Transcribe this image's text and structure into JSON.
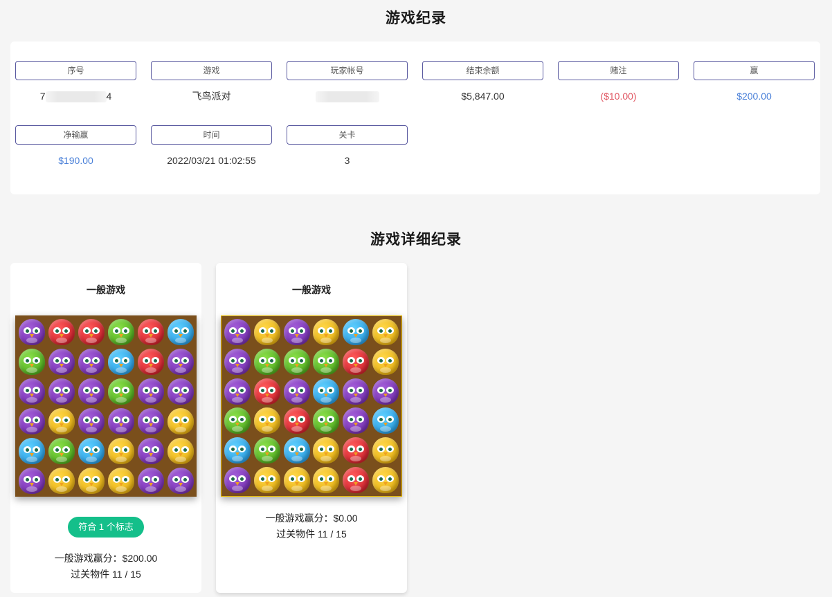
{
  "page_title": "游戏纪录",
  "summary": {
    "fields": [
      {
        "label": "序号",
        "value": "7",
        "value_tail": "4",
        "masked": "partial"
      },
      {
        "label": "游戏",
        "value": "飞鸟派对"
      },
      {
        "label": "玩家帐号",
        "value": "",
        "masked": "full"
      },
      {
        "label": "结束余额",
        "value": "$5,847.00"
      },
      {
        "label": "赌注",
        "value": "($10.00)",
        "tone": "neg"
      },
      {
        "label": "赢",
        "value": "$200.00",
        "tone": "pos"
      },
      {
        "label": "净输赢",
        "value": "$190.00",
        "tone": "pos"
      },
      {
        "label": "时间",
        "value": "2022/03/21 01:02:55"
      },
      {
        "label": "关卡",
        "value": "3"
      }
    ]
  },
  "detail_title": "游戏详细纪录",
  "details": [
    {
      "title": "一般游戏",
      "board": [
        [
          "purple",
          "red",
          "red",
          "green",
          "red",
          "blue"
        ],
        [
          "green",
          "purple",
          "purple",
          "blue",
          "red",
          "purple"
        ],
        [
          "purple",
          "purple",
          "purple",
          "green",
          "purple",
          "purple"
        ],
        [
          "purple",
          "yellow",
          "purple",
          "purple",
          "purple",
          "yellow"
        ],
        [
          "blue",
          "green",
          "blue",
          "yellow",
          "purple",
          "yellow"
        ],
        [
          "purple",
          "yellow",
          "yellow",
          "yellow",
          "purple",
          "purple"
        ]
      ],
      "badge": "符合 1 个标志",
      "score": "一般游戏赢分：$200.00",
      "objects": "过关物件 11 / 15"
    },
    {
      "title": "一般游戏",
      "board": [
        [
          "purple",
          "yellow",
          "purple",
          "yellow",
          "blue",
          "yellow"
        ],
        [
          "purple",
          "green",
          "green",
          "green",
          "red",
          "yellow"
        ],
        [
          "purple",
          "red",
          "purple",
          "blue",
          "purple",
          "purple"
        ],
        [
          "green",
          "yellow",
          "red",
          "green",
          "purple",
          "blue"
        ],
        [
          "blue",
          "green",
          "blue",
          "yellow",
          "red",
          "yellow"
        ],
        [
          "purple",
          "yellow",
          "yellow",
          "yellow",
          "red",
          "yellow"
        ]
      ],
      "score": "一般游戏赢分：$0.00",
      "objects": "过关物件 11 / 15"
    }
  ]
}
